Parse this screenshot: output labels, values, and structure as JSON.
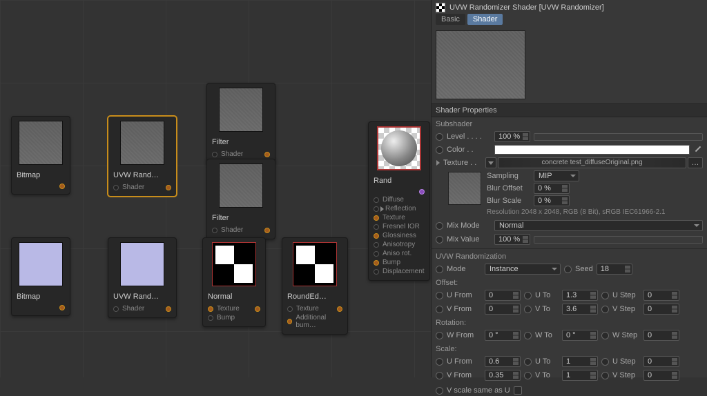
{
  "panel": {
    "title": "UVW Randomizer Shader [UVW Randomizer]",
    "tabs": {
      "basic": "Basic",
      "shader": "Shader"
    },
    "sections": {
      "shader_properties": "Shader Properties",
      "subshader": "Subshader",
      "uvw_randomization": "UVW Randomization",
      "offset": "Offset:",
      "rotation": "Rotation:",
      "scale": "Scale:"
    },
    "labels": {
      "level": "Level . . . .",
      "color": "Color . .",
      "texture": "Texture . .",
      "sampling": "Sampling",
      "blur_offset": "Blur Offset",
      "blur_scale": "Blur Scale",
      "mix_mode": "Mix Mode",
      "mix_value": "Mix Value",
      "mode": "Mode",
      "seed": "Seed",
      "u_from": "U From",
      "u_to": "U To",
      "u_step": "U Step",
      "v_from": "V From",
      "v_to": "V To",
      "v_step": "V Step",
      "w_from": "W From",
      "w_to": "W To",
      "w_step": "W Step",
      "v_same": "V scale same as U"
    },
    "values": {
      "level": "100 %",
      "color": "#ffffff",
      "texture_name": "concrete test_diffuseOriginal.png",
      "sampling": "MIP",
      "blur_offset": "0 %",
      "blur_scale": "0 %",
      "resolution": "Resolution 2048 x 2048, RGB (8 Bit), sRGB IEC61966-2.1",
      "mix_mode": "Normal",
      "mix_value": "100 %",
      "mode": "Instance",
      "seed": "18",
      "offset": {
        "u_from": "0",
        "u_to": "1.3",
        "u_step": "0",
        "v_from": "0",
        "v_to": "3.6",
        "v_step": "0"
      },
      "rotation": {
        "w_from": "0 °",
        "w_to": "0 °",
        "w_step": "0"
      },
      "scale": {
        "u_from": "0.6",
        "u_to": "1",
        "u_step": "0",
        "v_from": "0.35",
        "v_to": "1",
        "v_step": "0"
      },
      "v_same_checked": false
    }
  },
  "nodes": {
    "bitmap1": {
      "title": "Bitmap"
    },
    "uvw1": {
      "title": "UVW Rand…",
      "port": "Shader"
    },
    "filter1": {
      "title": "Filter",
      "port": "Shader"
    },
    "filter2": {
      "title": "Filter",
      "port": "Shader"
    },
    "rand": {
      "title": "Rand",
      "ports": [
        "Diffuse",
        "Reflection",
        "Texture",
        "Fresnel IOR",
        "Glossiness",
        "Anisotropy",
        "Aniso rot.",
        "Bump",
        "Displacement"
      ]
    },
    "bitmap2": {
      "title": "Bitmap"
    },
    "uvw2": {
      "title": "UVW Rand…",
      "port": "Shader"
    },
    "normal": {
      "title": "Normal",
      "ports": [
        "Texture",
        "Bump"
      ]
    },
    "rounded": {
      "title": "RoundEd…",
      "ports": [
        "Texture",
        "Additional bum…"
      ]
    }
  }
}
